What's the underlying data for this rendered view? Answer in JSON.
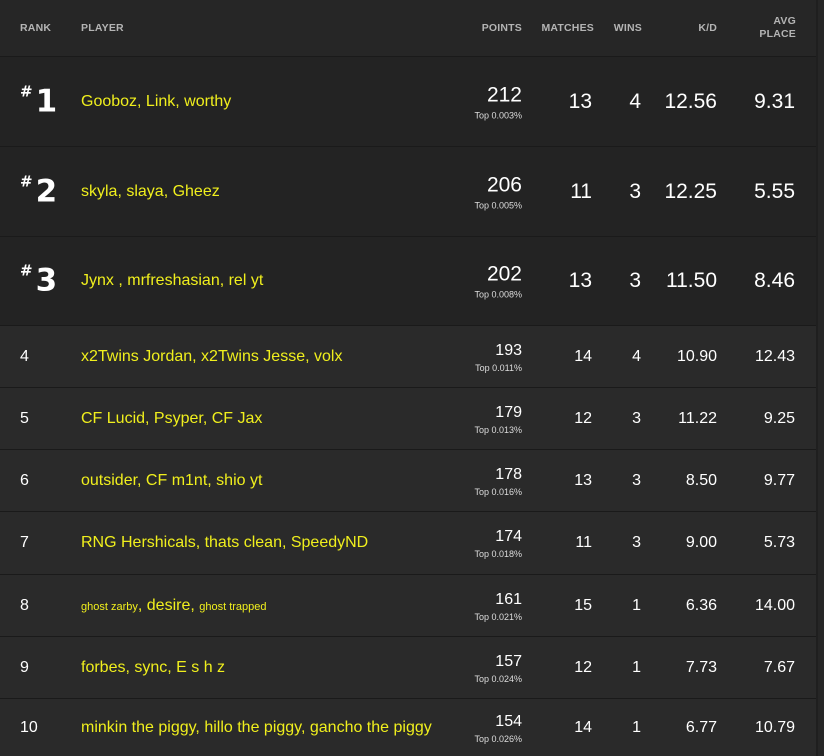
{
  "header": {
    "rank": "RANK",
    "player": "PLAYER",
    "points": "POINTS",
    "matches": "MATCHES",
    "wins": "WINS",
    "kd": "K/D",
    "avg_line1": "AVG",
    "avg_line2": "PLACE"
  },
  "rank_prefix": "#",
  "rows": [
    {
      "rank": "1",
      "players": "Gooboz, Link, worthy",
      "points": "212",
      "top": "Top 0.003%",
      "matches": "13",
      "wins": "4",
      "kd": "12.56",
      "avg": "9.31"
    },
    {
      "rank": "2",
      "players": "skyla, slaya, Gheez",
      "points": "206",
      "top": "Top 0.005%",
      "matches": "11",
      "wins": "3",
      "kd": "12.25",
      "avg": "5.55"
    },
    {
      "rank": "3",
      "players": "Jynx , mrfreshasian, rel yt",
      "points": "202",
      "top": "Top 0.008%",
      "matches": "13",
      "wins": "3",
      "kd": "11.50",
      "avg": "8.46"
    },
    {
      "rank": "4",
      "players": "x2Twins Jordan, x2Twins Jesse, volx",
      "points": "193",
      "top": "Top 0.011%",
      "matches": "14",
      "wins": "4",
      "kd": "10.90",
      "avg": "12.43"
    },
    {
      "rank": "5",
      "players": "CF Lucid, Psyper, CF Jax",
      "points": "179",
      "top": "Top 0.013%",
      "matches": "12",
      "wins": "3",
      "kd": "11.22",
      "avg": "9.25"
    },
    {
      "rank": "6",
      "players": "outsider, CF m1nt, shio yt",
      "points": "178",
      "top": "Top 0.016%",
      "matches": "13",
      "wins": "3",
      "kd": "8.50",
      "avg": "9.77"
    },
    {
      "rank": "7",
      "players": "RNG Hershicals, thats clean, SpeedyND",
      "points": "174",
      "top": "Top 0.018%",
      "matches": "11",
      "wins": "3",
      "kd": "9.00",
      "avg": "5.73"
    },
    {
      "rank": "8",
      "players_a": "ghost zarby",
      "players_sep1": ", ",
      "players_b": "desire",
      "players_sep2": ", ",
      "players_c": "ghost trapped",
      "points": "161",
      "top": "Top 0.021%",
      "matches": "15",
      "wins": "1",
      "kd": "6.36",
      "avg": "14.00"
    },
    {
      "rank": "9",
      "players": "forbes, sync, E s h z",
      "points": "157",
      "top": "Top 0.024%",
      "matches": "12",
      "wins": "1",
      "kd": "7.73",
      "avg": "7.67"
    },
    {
      "rank": "10",
      "players": "minkin the piggy, hillo the piggy, gancho the piggy",
      "points": "154",
      "top": "Top 0.026%",
      "matches": "14",
      "wins": "1",
      "kd": "6.77",
      "avg": "10.79"
    }
  ]
}
